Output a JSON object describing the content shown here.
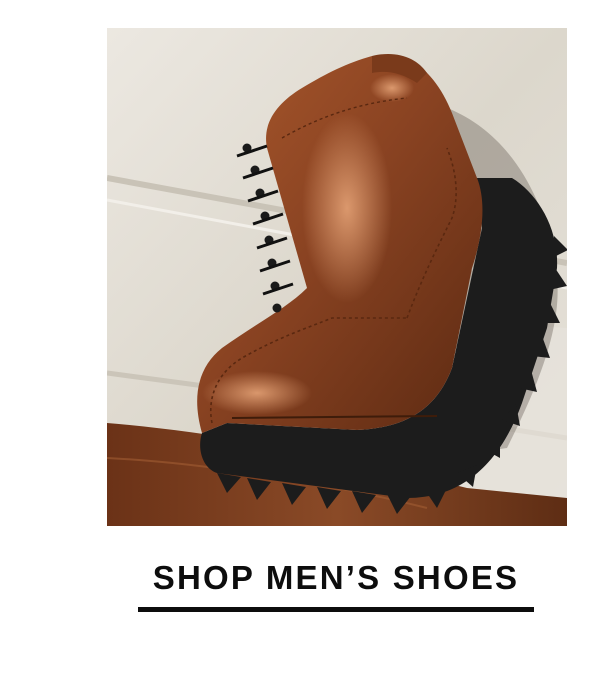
{
  "hero": {
    "image_subject": "brown leather lace-up lug-sole men's boot leaning against a wall"
  },
  "cta": {
    "label": "SHOP MEN’S SHOES"
  },
  "colors": {
    "background": "#ffffff",
    "text": "#0d0d0d",
    "boot_leather": "#8a4422",
    "sole": "#1c1c1c",
    "wall": "#e3dfd6",
    "floor": "#7a3d1e"
  }
}
